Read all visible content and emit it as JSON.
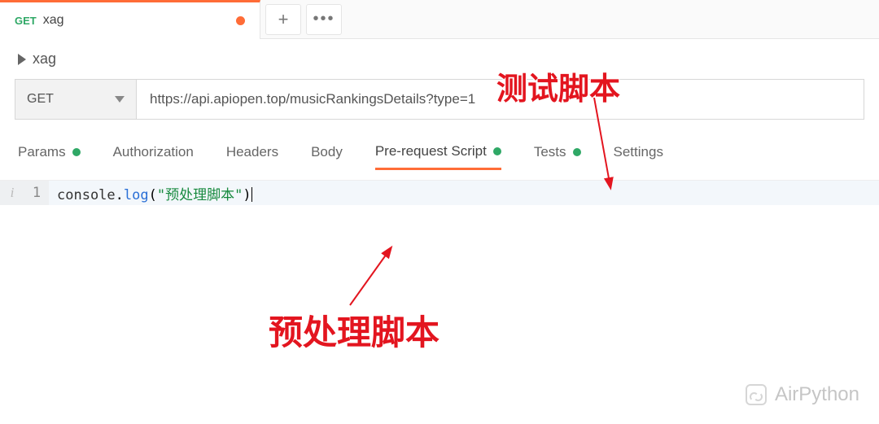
{
  "tab": {
    "method": "GET",
    "title": "xag",
    "dirty": true
  },
  "toolbar": {
    "add": "+",
    "more": "•••"
  },
  "breadcrumb": {
    "name": "xag"
  },
  "request": {
    "method": "GET",
    "url": "https://api.apiopen.top/musicRankingsDetails?type=1"
  },
  "req_tabs": {
    "params": "Params",
    "authorization": "Authorization",
    "headers": "Headers",
    "body": "Body",
    "prerequest": "Pre-request Script",
    "tests": "Tests",
    "settings": "Settings"
  },
  "editor": {
    "gutter_icon": "i",
    "line_no": "1",
    "code_obj": "console",
    "code_dot": ".",
    "code_fn": "log",
    "code_open": "(",
    "code_str": "\"预处理脚本\"",
    "code_close": ")"
  },
  "annotations": {
    "top": "测试脚本",
    "bottom": "预处理脚本"
  },
  "watermark": "AirPython"
}
